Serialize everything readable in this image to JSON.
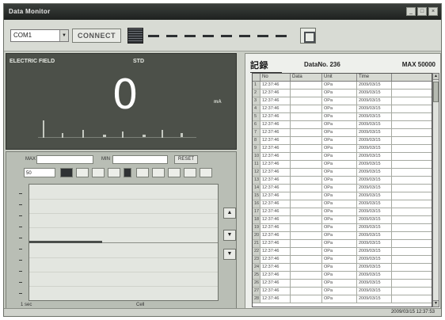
{
  "window": {
    "title": "Data Monitor"
  },
  "toolbar": {
    "port_value": "COM1",
    "connect_label": "CONNECT",
    "icons": [
      "grid-icon",
      "dash-icon",
      "document-icon"
    ]
  },
  "display": {
    "left_label": "ELECTRIC FIELD",
    "mid_label": "STD",
    "value": "0",
    "unit": "mA"
  },
  "wave": {
    "ctrl1": {
      "label_a": "MAX",
      "label_b": "MIN",
      "button": "RESET"
    },
    "range_value": "50",
    "x_left": "1 sec",
    "x_mid": "Cell",
    "side_buttons": [
      "▲",
      "▼",
      "▼"
    ]
  },
  "table": {
    "title": "記録",
    "data_no_label": "DataNo. 236",
    "max_label": "MAX 50000",
    "headers": [
      "No",
      "Data",
      "Unit",
      "Time"
    ],
    "rows": [
      [
        "1",
        "12:37:46",
        "",
        "OPa",
        "2009/03/15"
      ],
      [
        "2",
        "12:37:46",
        "",
        "OPa",
        "2009/03/15"
      ],
      [
        "3",
        "12:37:46",
        "",
        "OPa",
        "2009/03/15"
      ],
      [
        "4",
        "12:37:46",
        "",
        "OPa",
        "2009/03/15"
      ],
      [
        "5",
        "12:37:46",
        "",
        "OPa",
        "2009/03/15"
      ],
      [
        "6",
        "12:37:46",
        "",
        "OPa",
        "2009/03/15"
      ],
      [
        "7",
        "12:37:46",
        "",
        "OPa",
        "2009/03/15"
      ],
      [
        "8",
        "12:37:46",
        "",
        "OPa",
        "2009/03/15"
      ],
      [
        "9",
        "12:37:46",
        "",
        "OPa",
        "2009/03/15"
      ],
      [
        "10",
        "12:37:46",
        "",
        "OPa",
        "2009/03/15"
      ],
      [
        "11",
        "12:37:46",
        "",
        "OPa",
        "2009/03/15"
      ],
      [
        "12",
        "12:37:46",
        "",
        "OPa",
        "2009/03/15"
      ],
      [
        "13",
        "12:37:46",
        "",
        "OPa",
        "2009/03/15"
      ],
      [
        "14",
        "12:37:46",
        "",
        "OPa",
        "2009/03/15"
      ],
      [
        "15",
        "12:37:46",
        "",
        "OPa",
        "2009/03/15"
      ],
      [
        "16",
        "12:37:46",
        "",
        "OPa",
        "2009/03/15"
      ],
      [
        "17",
        "12:37:46",
        "",
        "OPa",
        "2009/03/15"
      ],
      [
        "18",
        "12:37:46",
        "",
        "OPa",
        "2009/03/15"
      ],
      [
        "19",
        "12:37:46",
        "",
        "OPa",
        "2009/03/15"
      ],
      [
        "20",
        "12:37:46",
        "",
        "OPa",
        "2009/03/15"
      ],
      [
        "21",
        "12:37:46",
        "",
        "OPa",
        "2009/03/15"
      ],
      [
        "22",
        "12:37:46",
        "",
        "OPa",
        "2009/03/15"
      ],
      [
        "23",
        "12:37:46",
        "",
        "OPa",
        "2009/03/15"
      ],
      [
        "24",
        "12:37:46",
        "",
        "OPa",
        "2009/03/15"
      ],
      [
        "25",
        "12:37:46",
        "",
        "OPa",
        "2009/03/15"
      ],
      [
        "26",
        "12:37:46",
        "",
        "OPa",
        "2009/03/15"
      ],
      [
        "27",
        "12:37:46",
        "",
        "OPa",
        "2009/03/15"
      ],
      [
        "28",
        "12:37:46",
        "",
        "OPa",
        "2009/03/15"
      ]
    ]
  },
  "status": {
    "time": "2009/03/15 12:37:53"
  },
  "colors": {
    "display_bg": "#4c5049",
    "panel_bg": "#c9cdc4",
    "titlebar": "#2a2d2b"
  }
}
